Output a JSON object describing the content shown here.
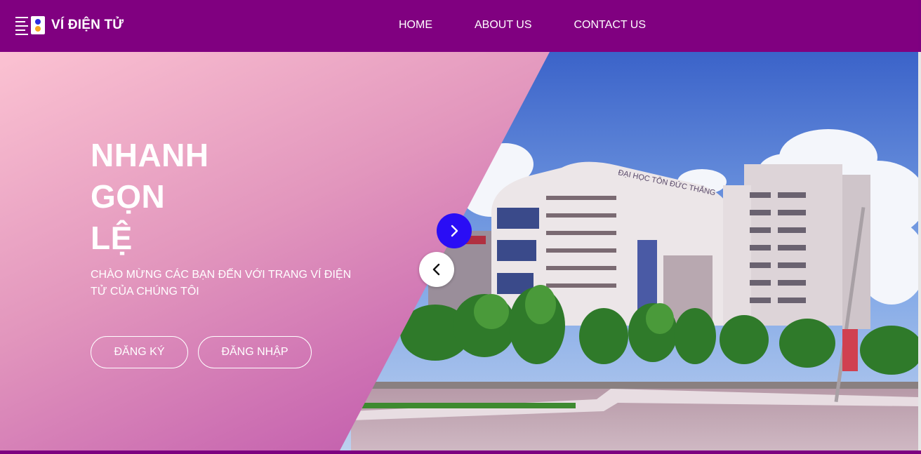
{
  "brand": {
    "name": "VÍ ĐIỆN TỬ",
    "logo_icon": "wallet-logo-icon"
  },
  "nav": {
    "items": [
      {
        "label": "HOME"
      },
      {
        "label": "ABOUT US"
      },
      {
        "label": "CONTACT US"
      }
    ]
  },
  "hero": {
    "headline": [
      "NHANH",
      "GỌN",
      "LỆ"
    ],
    "subtitle": "CHÀO MỪNG CÁC BẠN ĐẾN VỚI TRANG VÍ ĐIỆN TỬ CỦA CHÚNG TÔI",
    "register_label": "ĐĂNG KÝ",
    "login_label": "ĐĂNG NHẬP",
    "next_icon": "chevron-right-icon",
    "prev_icon": "chevron-left-icon",
    "photo_sign": "ĐẠI HỌC TÔN ĐỨC THẮNG"
  },
  "colors": {
    "navbar": "#800080",
    "gradient_start": "#fbc2d2",
    "gradient_end": "#a13b9a",
    "next_button": "#2a0df5",
    "text": "#ffffff"
  }
}
